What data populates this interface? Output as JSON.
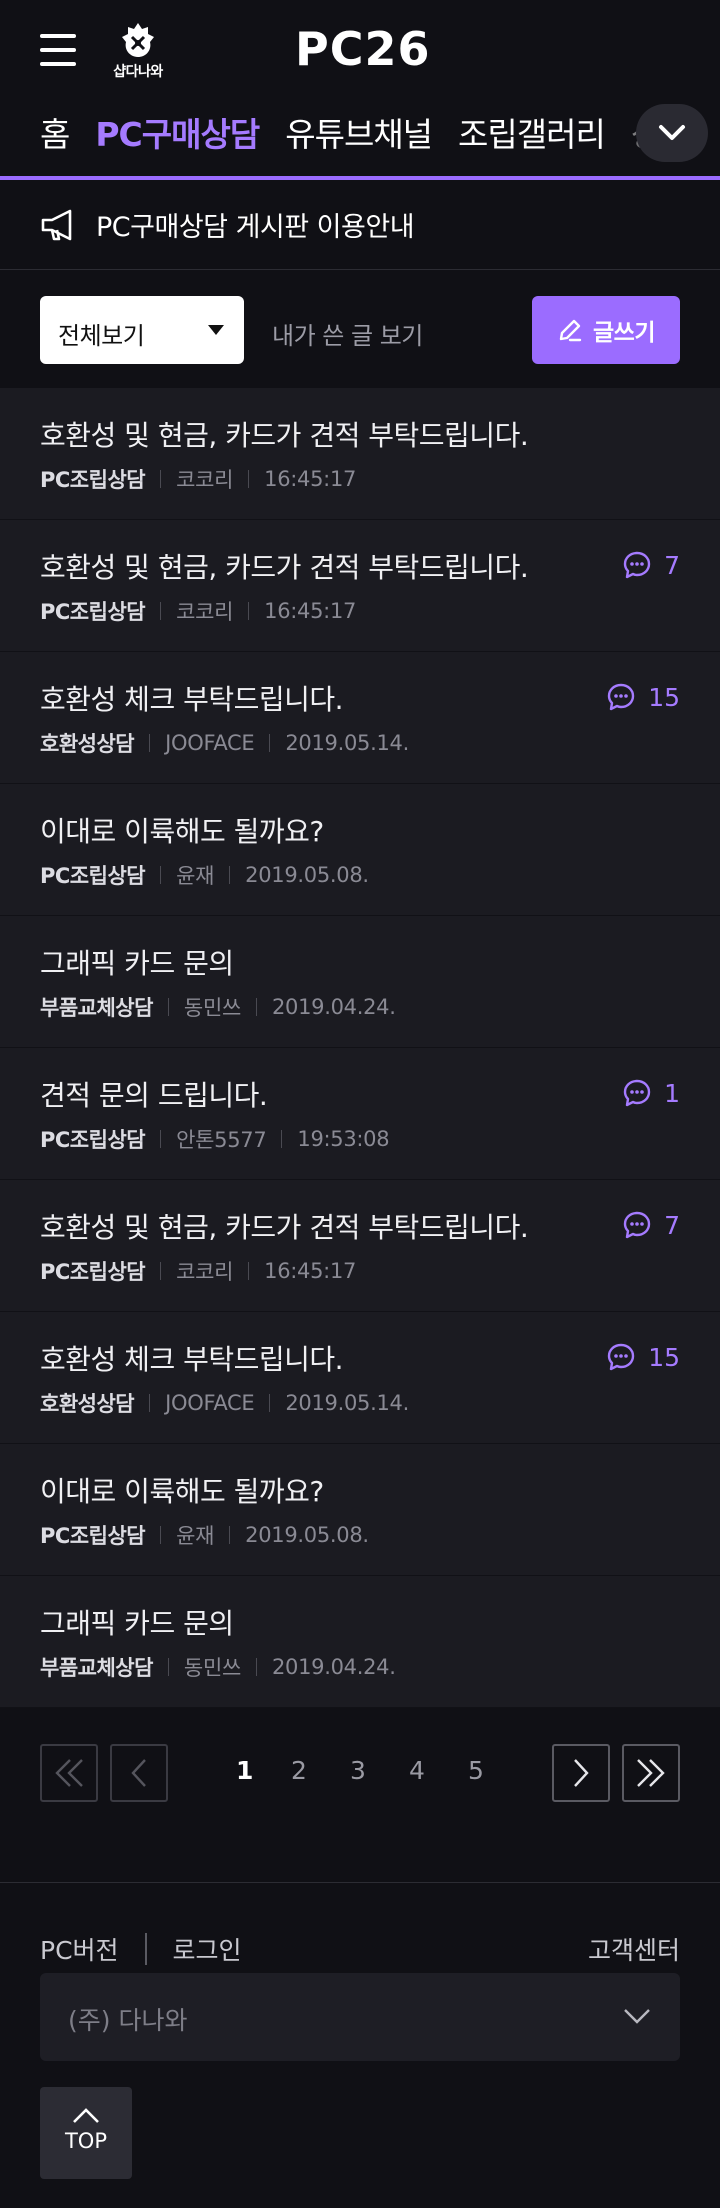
{
  "header": {
    "danawa_logo_text": "샵다나와",
    "brand": "PC26"
  },
  "nav": {
    "items": [
      {
        "label": "홈",
        "active": false
      },
      {
        "label": "PC구매상담",
        "active": true
      },
      {
        "label": "유튜브채널",
        "active": false
      },
      {
        "label": "조립갤러리",
        "active": false
      },
      {
        "label": "상품포럼",
        "active": false
      }
    ],
    "accent_color": "#9b6cff"
  },
  "notice": {
    "text": "PC구매상담 게시판 이용안내"
  },
  "filter": {
    "select_value": "전체보기",
    "my_posts_label": "내가 쓴 글 보기",
    "write_label": "글쓰기"
  },
  "posts": [
    {
      "title": "호환성 및 현금, 카드가 견적 부탁드립니다.",
      "category": "PC조립상담",
      "author": "코코리",
      "date": "16:45:17",
      "comments": ""
    },
    {
      "title": "호환성 및 현금, 카드가 견적 부탁드립니다.",
      "category": "PC조립상담",
      "author": "코코리",
      "date": "16:45:17",
      "comments": "7"
    },
    {
      "title": "호환성 체크 부탁드립니다.",
      "category": "호환성상담",
      "author": "JOOFACE",
      "date": "2019.05.14.",
      "comments": "15"
    },
    {
      "title": "이대로 이륙해도 될까요?",
      "category": "PC조립상담",
      "author": "윤재",
      "date": "2019.05.08.",
      "comments": ""
    },
    {
      "title": "그래픽 카드 문의",
      "category": "부품교체상담",
      "author": "동민쓰",
      "date": "2019.04.24.",
      "comments": ""
    },
    {
      "title": "견적 문의 드립니다.",
      "category": "PC조립상담",
      "author": "안톤5577",
      "date": "19:53:08",
      "comments": "1"
    },
    {
      "title": "호환성 및 현금, 카드가 견적 부탁드립니다.",
      "category": "PC조립상담",
      "author": "코코리",
      "date": "16:45:17",
      "comments": "7"
    },
    {
      "title": "호환성 체크 부탁드립니다.",
      "category": "호환성상담",
      "author": "JOOFACE",
      "date": "2019.05.14.",
      "comments": "15"
    },
    {
      "title": "이대로 이륙해도 될까요?",
      "category": "PC조립상담",
      "author": "윤재",
      "date": "2019.05.08.",
      "comments": ""
    },
    {
      "title": "그래픽 카드 문의",
      "category": "부품교체상담",
      "author": "동민쓰",
      "date": "2019.04.24.",
      "comments": ""
    }
  ],
  "pagination": {
    "pages": [
      "1",
      "2",
      "3",
      "4",
      "5"
    ],
    "current": "1"
  },
  "footer": {
    "pc_version_label": "PC버전",
    "login_label": "로그인",
    "customer_center_label": "고객센터",
    "company_select": "(주) 다나와",
    "top_label": "TOP"
  }
}
